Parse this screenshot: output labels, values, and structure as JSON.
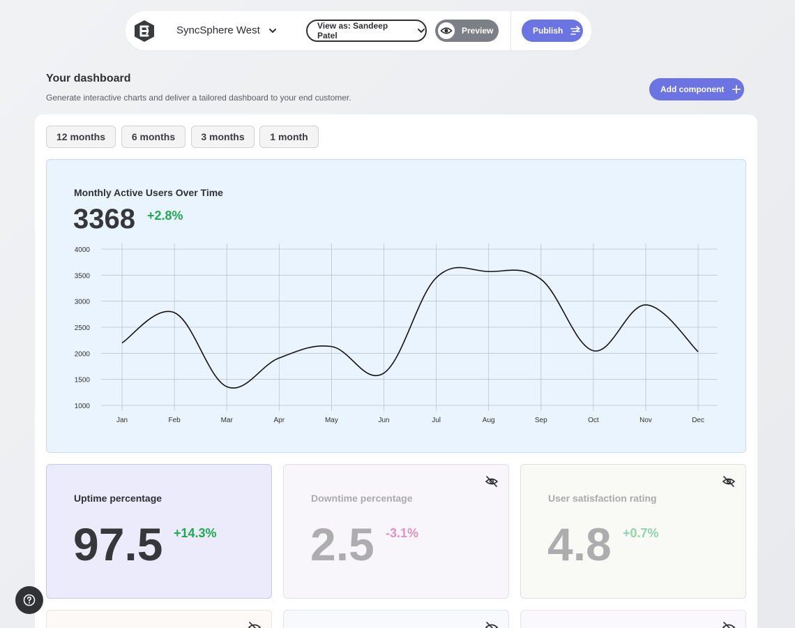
{
  "toolbar": {
    "workspace_name": "SyncSphere West",
    "view_as_label": "View as: Sandeep Patel",
    "preview_label": "Preview",
    "publish_label": "Publish"
  },
  "header": {
    "title": "Your dashboard",
    "subtitle": "Generate interactive charts and deliver a tailored dashboard to your end customer.",
    "add_component_label": "Add component"
  },
  "ranges": [
    "12 months",
    "6 months",
    "3 months",
    "1 month"
  ],
  "chart_card": {
    "title": "Monthly Active Users Over Time",
    "value": "3368",
    "change": "+2.8%"
  },
  "chart_data": {
    "type": "line",
    "title": "Monthly Active Users Over Time",
    "categories": [
      "Jan",
      "Feb",
      "Mar",
      "Apr",
      "May",
      "Jun",
      "Jul",
      "Aug",
      "Sep",
      "Oct",
      "Nov",
      "Dec"
    ],
    "values": [
      2200,
      2780,
      1360,
      1910,
      2130,
      1620,
      3450,
      3570,
      3420,
      2050,
      2930,
      2030
    ],
    "yticks": [
      1000,
      1500,
      2000,
      2500,
      3000,
      3500,
      4000
    ],
    "ylim": [
      1000,
      4000
    ],
    "grid": true,
    "line_color": "#111111"
  },
  "metrics": [
    {
      "title": "Uptime percentage",
      "value": "97.5",
      "change": "+14.3%",
      "hidden": false
    },
    {
      "title": "Downtime percentage",
      "value": "2.5",
      "change": "-3.1%",
      "hidden": true
    },
    {
      "title": "User satisfaction rating",
      "value": "4.8",
      "change": "+0.7%",
      "hidden": true
    }
  ],
  "colors": {
    "accent": "#6b74e0",
    "positive": "#1eaa4f",
    "negative": "#d4589e",
    "chart_bg": "#eaf4fe"
  },
  "icons": {
    "logo": "brand-logo-icon",
    "chevron": "chevron-down-icon",
    "eye": "eye-icon",
    "publish": "publish-icon",
    "plus": "plus-icon",
    "hide": "eye-off-icon",
    "help": "help-icon"
  }
}
